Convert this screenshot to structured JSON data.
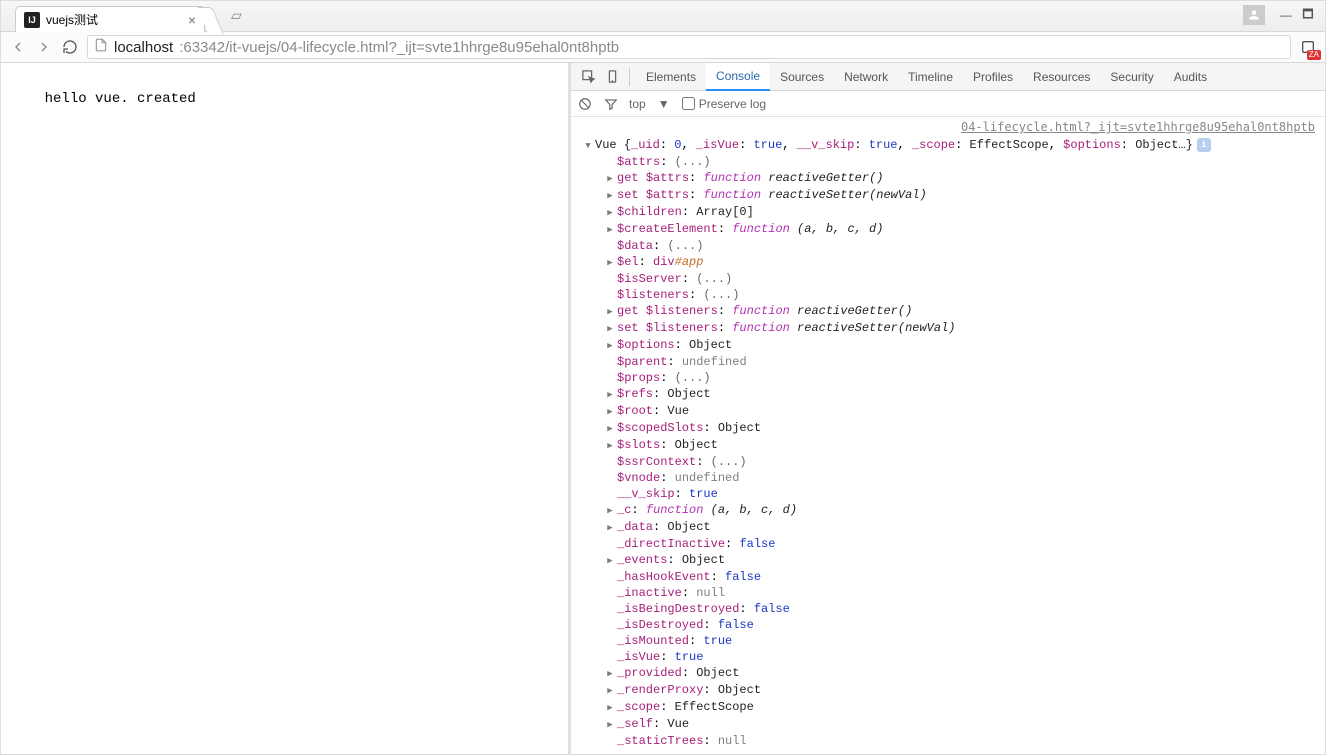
{
  "browser": {
    "tab_title": "vuejs测试",
    "tab_favicon_text": "IJ",
    "url_host": "localhost",
    "url_rest": ":63342/it-vuejs/04-lifecycle.html?_ijt=svte1hhrge8u95ehal0nt8hptb",
    "ext_badge": "ZA"
  },
  "page": {
    "body_text": "hello vue. created"
  },
  "devtools": {
    "tabs": [
      "Elements",
      "Console",
      "Sources",
      "Network",
      "Timeline",
      "Profiles",
      "Resources",
      "Security",
      "Audits"
    ],
    "active_tab": "Console",
    "toolbar": {
      "context": "top",
      "preserve_label": "Preserve log"
    },
    "source_link": "04-lifecycle.html?_ijt=svte1hhrge8u95ehal0nt8hptb",
    "root_summary": {
      "class": "Vue",
      "pairs": [
        {
          "k": "_uid",
          "v": "0",
          "t": "num"
        },
        {
          "k": "_isVue",
          "v": "true",
          "t": "bool"
        },
        {
          "k": "__v_skip",
          "v": "true",
          "t": "bool"
        },
        {
          "k": "_scope",
          "v": "EffectScope",
          "t": "type"
        },
        {
          "k": "$options",
          "v": "Object…",
          "t": "type"
        }
      ]
    },
    "props": [
      {
        "tri": "none",
        "key": "$attrs",
        "sep": ": ",
        "val": "(...)",
        "cls": "ellipsis"
      },
      {
        "tri": "right",
        "prefix": "get ",
        "key": "$attrs",
        "sep": ": ",
        "func": "reactiveGetter()"
      },
      {
        "tri": "right",
        "prefix": "set ",
        "key": "$attrs",
        "sep": ": ",
        "func": "reactiveSetter(newVal)"
      },
      {
        "tri": "right",
        "key": "$children",
        "sep": ": ",
        "val": "Array[0]",
        "cls": "type"
      },
      {
        "tri": "right",
        "key": "$createElement",
        "sep": ": ",
        "func": "(a, b, c, d)"
      },
      {
        "tri": "none",
        "key": "$data",
        "sep": ": ",
        "val": "(...)",
        "cls": "ellipsis"
      },
      {
        "tri": "right",
        "key": "$el",
        "sep": ": ",
        "selector": "div#app"
      },
      {
        "tri": "none",
        "key": "$isServer",
        "sep": ": ",
        "val": "(...)",
        "cls": "ellipsis"
      },
      {
        "tri": "none",
        "key": "$listeners",
        "sep": ": ",
        "val": "(...)",
        "cls": "ellipsis"
      },
      {
        "tri": "right",
        "prefix": "get ",
        "key": "$listeners",
        "sep": ": ",
        "func": "reactiveGetter()"
      },
      {
        "tri": "right",
        "prefix": "set ",
        "key": "$listeners",
        "sep": ": ",
        "func": "reactiveSetter(newVal)"
      },
      {
        "tri": "right",
        "key": "$options",
        "sep": ": ",
        "val": "Object",
        "cls": "type"
      },
      {
        "tri": "none",
        "key": "$parent",
        "sep": ": ",
        "val": "undefined",
        "cls": "nul"
      },
      {
        "tri": "none",
        "key": "$props",
        "sep": ": ",
        "val": "(...)",
        "cls": "ellipsis"
      },
      {
        "tri": "right",
        "key": "$refs",
        "sep": ": ",
        "val": "Object",
        "cls": "type"
      },
      {
        "tri": "right",
        "key": "$root",
        "sep": ": ",
        "val": "Vue",
        "cls": "type"
      },
      {
        "tri": "right",
        "key": "$scopedSlots",
        "sep": ": ",
        "val": "Object",
        "cls": "type"
      },
      {
        "tri": "right",
        "key": "$slots",
        "sep": ": ",
        "val": "Object",
        "cls": "type"
      },
      {
        "tri": "none",
        "key": "$ssrContext",
        "sep": ": ",
        "val": "(...)",
        "cls": "ellipsis"
      },
      {
        "tri": "none",
        "key": "$vnode",
        "sep": ": ",
        "val": "undefined",
        "cls": "nul"
      },
      {
        "tri": "none",
        "key": "__v_skip",
        "sep": ": ",
        "val": "true",
        "cls": "bool"
      },
      {
        "tri": "right",
        "key": "_c",
        "sep": ": ",
        "func": "(a, b, c, d)"
      },
      {
        "tri": "right",
        "key": "_data",
        "sep": ": ",
        "val": "Object",
        "cls": "type"
      },
      {
        "tri": "none",
        "key": "_directInactive",
        "sep": ": ",
        "val": "false",
        "cls": "bool"
      },
      {
        "tri": "right",
        "key": "_events",
        "sep": ": ",
        "val": "Object",
        "cls": "type"
      },
      {
        "tri": "none",
        "key": "_hasHookEvent",
        "sep": ": ",
        "val": "false",
        "cls": "bool"
      },
      {
        "tri": "none",
        "key": "_inactive",
        "sep": ": ",
        "val": "null",
        "cls": "nul"
      },
      {
        "tri": "none",
        "key": "_isBeingDestroyed",
        "sep": ": ",
        "val": "false",
        "cls": "bool"
      },
      {
        "tri": "none",
        "key": "_isDestroyed",
        "sep": ": ",
        "val": "false",
        "cls": "bool"
      },
      {
        "tri": "none",
        "key": "_isMounted",
        "sep": ": ",
        "val": "true",
        "cls": "bool"
      },
      {
        "tri": "none",
        "key": "_isVue",
        "sep": ": ",
        "val": "true",
        "cls": "bool"
      },
      {
        "tri": "right",
        "key": "_provided",
        "sep": ": ",
        "val": "Object",
        "cls": "type"
      },
      {
        "tri": "right",
        "key": "_renderProxy",
        "sep": ": ",
        "val": "Object",
        "cls": "type"
      },
      {
        "tri": "right",
        "key": "_scope",
        "sep": ": ",
        "val": "EffectScope",
        "cls": "type"
      },
      {
        "tri": "right",
        "key": "_self",
        "sep": ": ",
        "val": "Vue",
        "cls": "type"
      },
      {
        "tri": "none",
        "key": "_staticTrees",
        "sep": ": ",
        "val": "null",
        "cls": "nul"
      }
    ]
  }
}
